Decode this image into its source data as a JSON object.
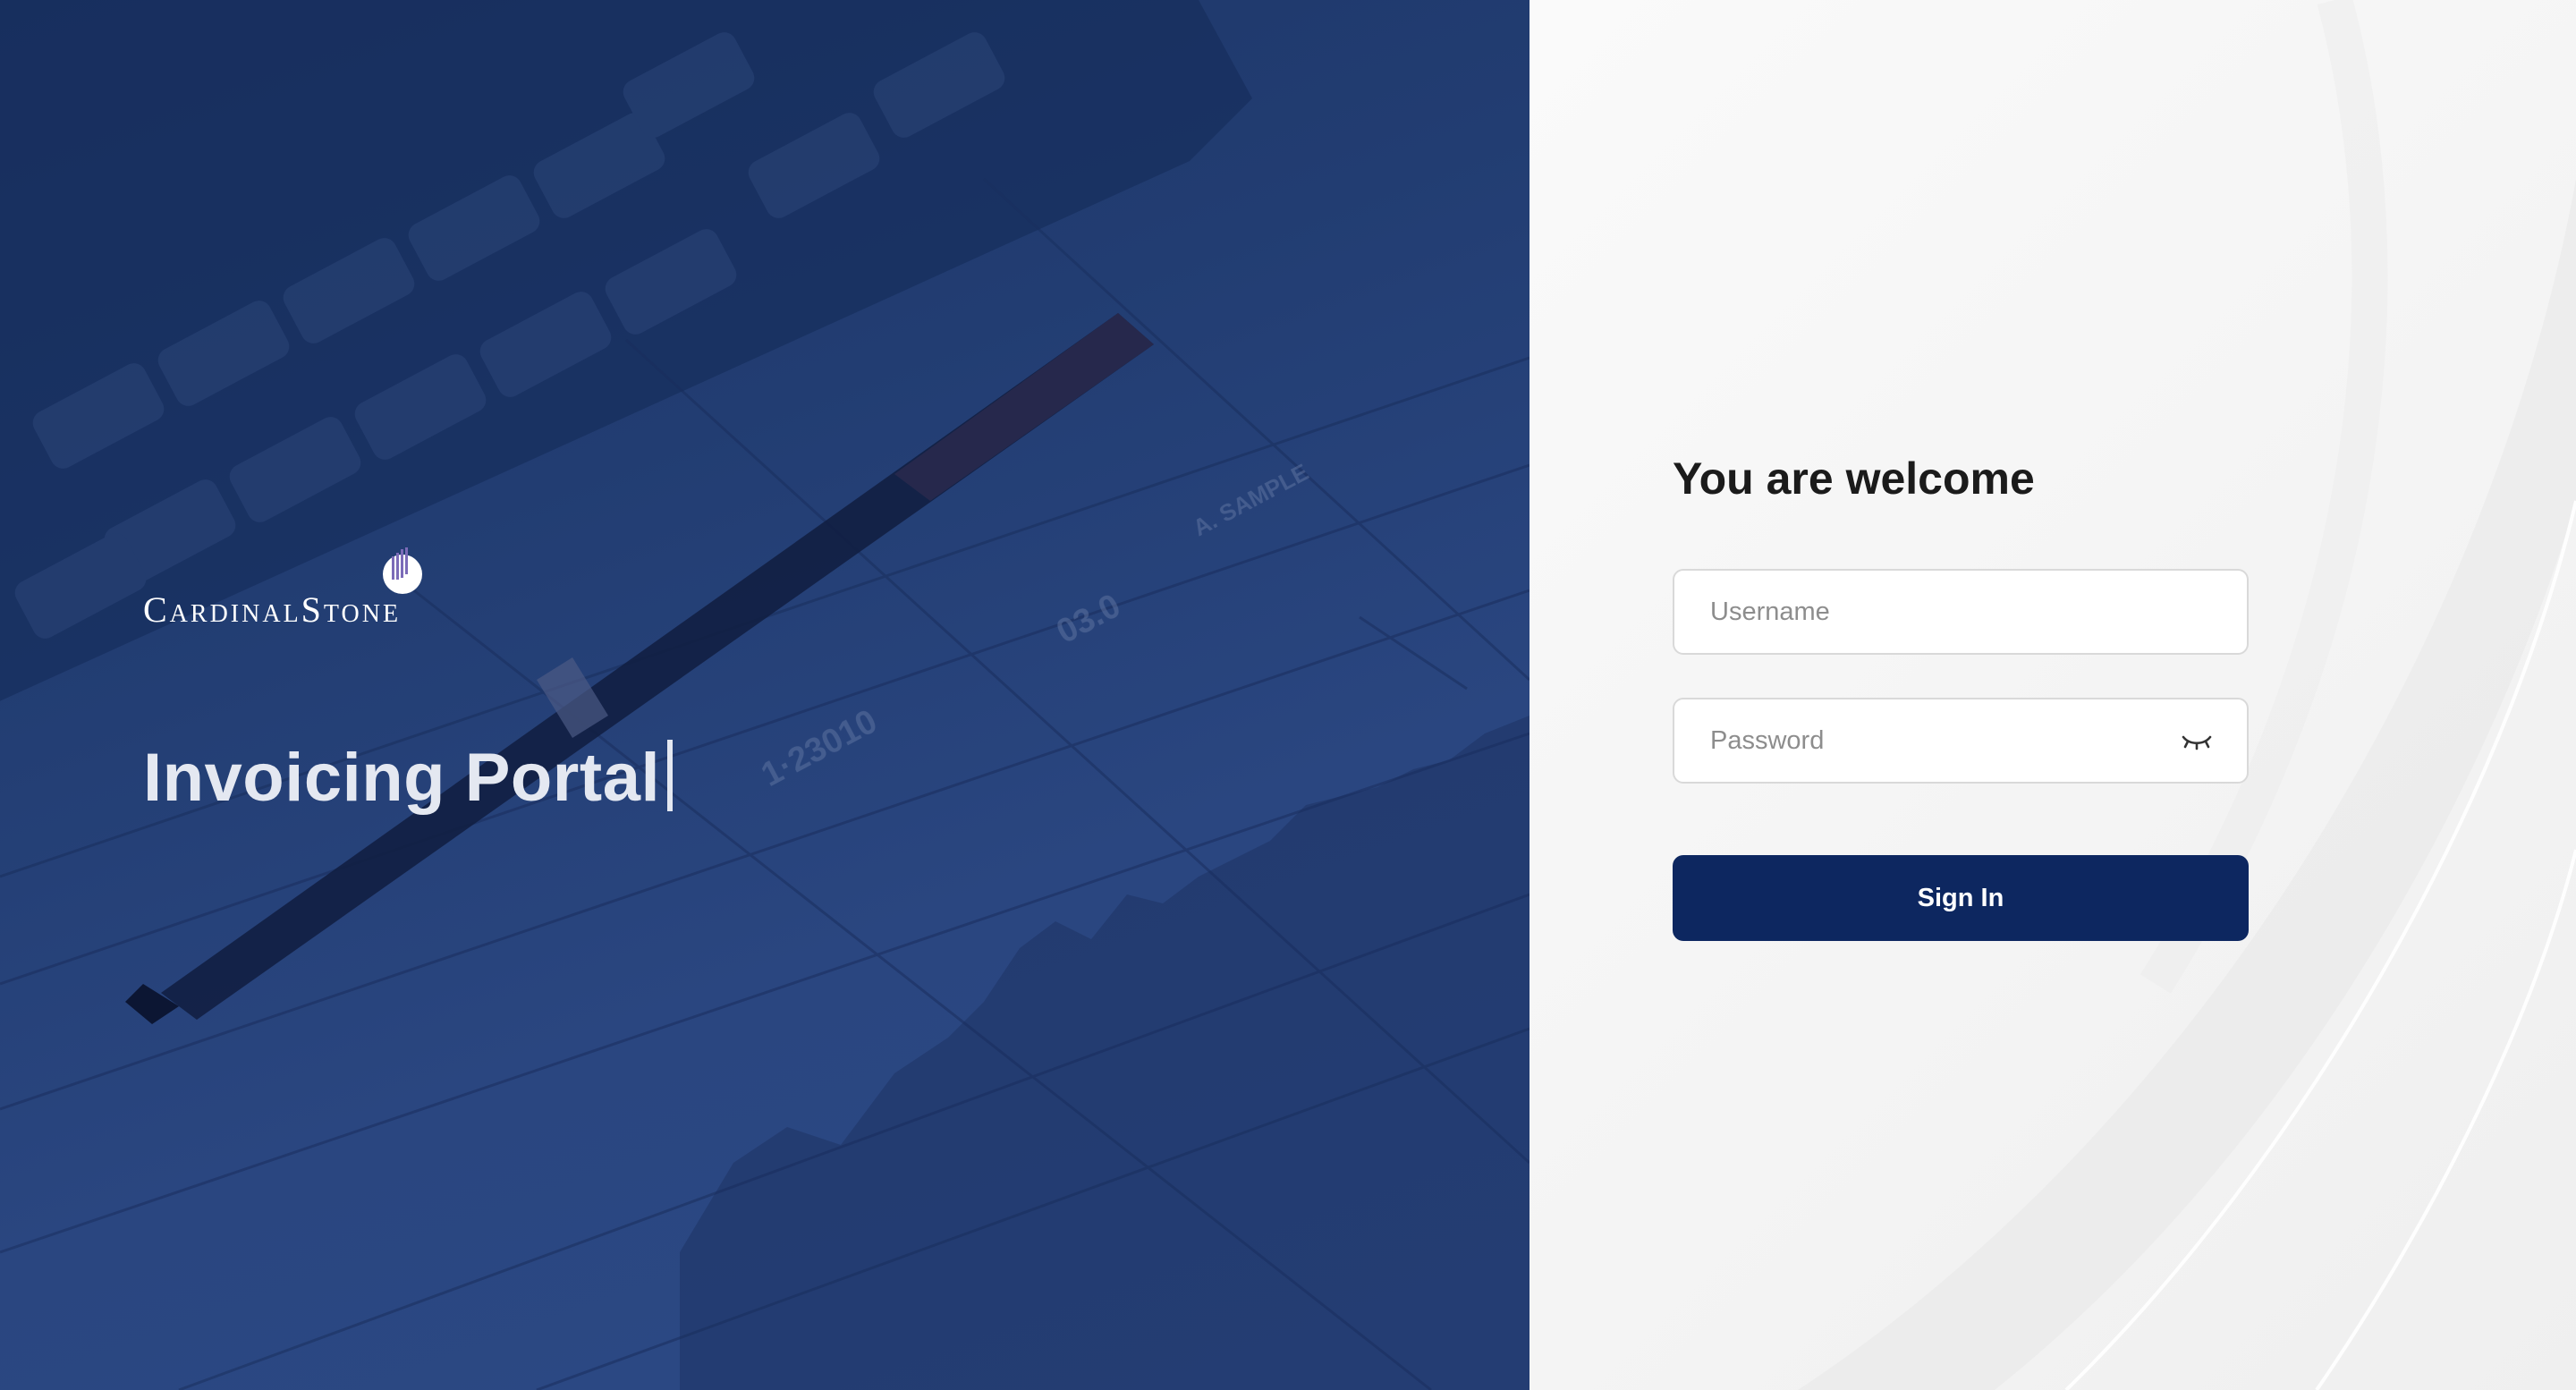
{
  "hero": {
    "brand_name": "CardinalStone",
    "title": "Invoicing Portal"
  },
  "login": {
    "heading": "You are welcome",
    "username_placeholder": "Username",
    "password_placeholder": "Password",
    "password_toggle_icon": "eye-closed-icon",
    "submit_label": "Sign In"
  },
  "colors": {
    "hero_overlay": "#223d72",
    "primary_button": "#0d2760",
    "heading_text": "#1b1b1b",
    "page_background": "#f3f3f3"
  }
}
